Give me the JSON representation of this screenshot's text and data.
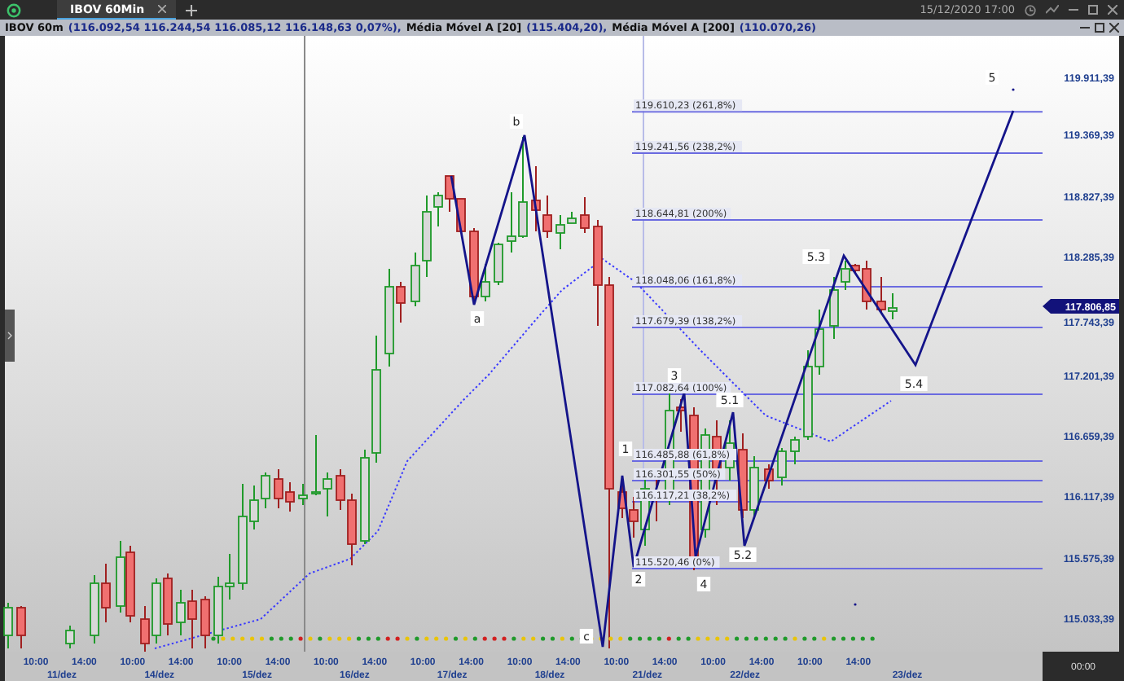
{
  "tab_bar": {
    "tabs": [
      {
        "label": "IBOV 60Min",
        "selected": true
      }
    ],
    "datetime": "15/12/2020 17:00"
  },
  "info_bar": {
    "segments": [
      {
        "kind": "label",
        "text": "IBOV 60m"
      },
      {
        "kind": "value",
        "text": "(116.092,54  116.244,54  116.085,12  116.148,63  0,07%),"
      },
      {
        "kind": "label",
        "text": "Média Móvel A [20]"
      },
      {
        "kind": "value",
        "text": "(115.404,20),"
      },
      {
        "kind": "label",
        "text": "Média Móvel A [200]"
      },
      {
        "kind": "value",
        "text": "(110.070,26)"
      }
    ]
  },
  "price_axis": {
    "labels": [
      "119.911,39",
      "119.369,39",
      "118.827,39",
      "118.285,39",
      "117.743,39",
      "117.201,39",
      "116.659,39",
      "116.117,39",
      "115.575,39",
      "115.033,39"
    ],
    "current_price": "117.806,85"
  },
  "fib_levels": [
    {
      "label": "119.610,23 (261,8%)"
    },
    {
      "label": "119.241,56 (238,2%)"
    },
    {
      "label": "118.644,81 (200%)"
    },
    {
      "label": "118.048,06 (161,8%)"
    },
    {
      "label": "117.679,39 (138,2%)"
    },
    {
      "label": "117.082,64 (100%)"
    },
    {
      "label": "116.485,88 (61,8%)"
    },
    {
      "label": "116.301,55 (50%)"
    },
    {
      "label": "116.117,21 (38,2%)"
    },
    {
      "label": "115.520,46 (0%)"
    }
  ],
  "wave_labels": [
    "b",
    "a",
    "c",
    "1",
    "2",
    "3",
    "4",
    "5.1",
    "5.2",
    "5.3",
    "5.4",
    "5"
  ],
  "time_axis": {
    "times": [
      "10:00",
      "14:00",
      "10:00",
      "14:00",
      "10:00",
      "14:00",
      "10:00",
      "14:00",
      "10:00",
      "14:00",
      "10:00",
      "14:00",
      "10:00",
      "14:00",
      "10:00",
      "14:00",
      "10:00",
      "14:00"
    ],
    "dates": [
      "11/dez",
      "14/dez",
      "15/dez",
      "16/dez",
      "17/dez",
      "18/dez",
      "21/dez",
      "22/dez",
      "23/dez"
    ],
    "corner": "00:00"
  }
}
